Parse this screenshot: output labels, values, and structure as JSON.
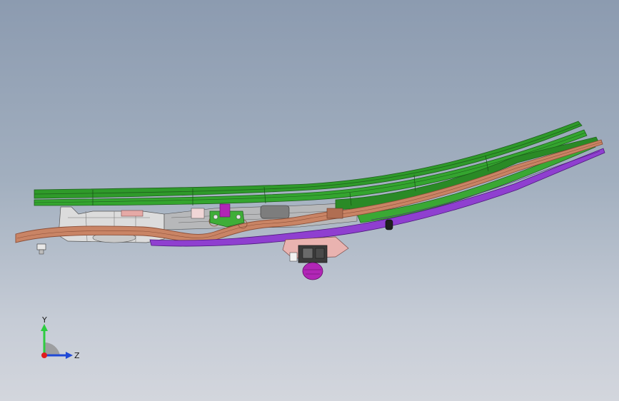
{
  "viewport": {
    "background_top": "#8c9bb0",
    "background_bottom": "#d3d6dd"
  },
  "model": {
    "colors": {
      "green_panel": "#2f9a2a",
      "green_dark": "#1e5f1c",
      "copper_rail": "#c98465",
      "copper_dark": "#8c4f38",
      "purple_rail": "#8f3fd0",
      "purple_dark": "#4e1a7c",
      "grey_frame": "#d8d8d8",
      "pink_part": "#e9b3b0",
      "magenta_part": "#b126b6"
    }
  },
  "triad": {
    "y_label": "Y",
    "z_label": "Z",
    "y_color": "#2ecc40",
    "z_color": "#1f49d6",
    "x_color": "#e01d1d"
  }
}
